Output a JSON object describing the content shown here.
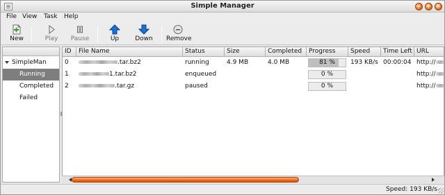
{
  "window": {
    "title": "Simple Manager"
  },
  "menu": [
    "File",
    "View",
    "Task",
    "Help"
  ],
  "toolbar": {
    "new": "New",
    "play": "Play",
    "pause": "Pause",
    "up": "Up",
    "down": "Down",
    "remove": "Remove"
  },
  "sidebar": {
    "root": "SimpleMan",
    "items": [
      "Running",
      "Completed",
      "Failed"
    ],
    "selected": "Running"
  },
  "table": {
    "columns": [
      "ID",
      "File Name",
      "Status",
      "Size",
      "Completed",
      "Progress",
      "Speed",
      "Time Left",
      "URL"
    ],
    "rows": [
      {
        "id": "0",
        "file_suffix": ".tar.bz2",
        "status": "running",
        "size": "4.9 MB",
        "completed": "4.0 MB",
        "progress_text": "81 %",
        "progress": 81,
        "speed": "193 KB/s",
        "time_left": "00:00:04",
        "url_prefix": "http://"
      },
      {
        "id": "1",
        "file_suffix": "1.tar.bz2",
        "status": "enqueued",
        "size": "",
        "completed": "",
        "progress_text": "0 %",
        "progress": 0,
        "speed": "",
        "time_left": "",
        "url_prefix": "http://"
      },
      {
        "id": "2",
        "file_suffix": ".tar.gz",
        "status": "paused",
        "size": "",
        "completed": "",
        "progress_text": "0 %",
        "progress": 0,
        "speed": "",
        "time_left": "",
        "url_prefix": "http://"
      }
    ]
  },
  "status": {
    "text": "Speed: 193 KB/s"
  },
  "colors": {
    "accent": "#f06a18",
    "selection": "#7e7e7e",
    "arrow_blue": "#1d6fd8",
    "new_green": "#3a9a2c"
  },
  "icons": [
    "new-icon",
    "play-icon",
    "pause-icon",
    "up-arrow-icon",
    "down-arrow-icon",
    "remove-icon"
  ]
}
